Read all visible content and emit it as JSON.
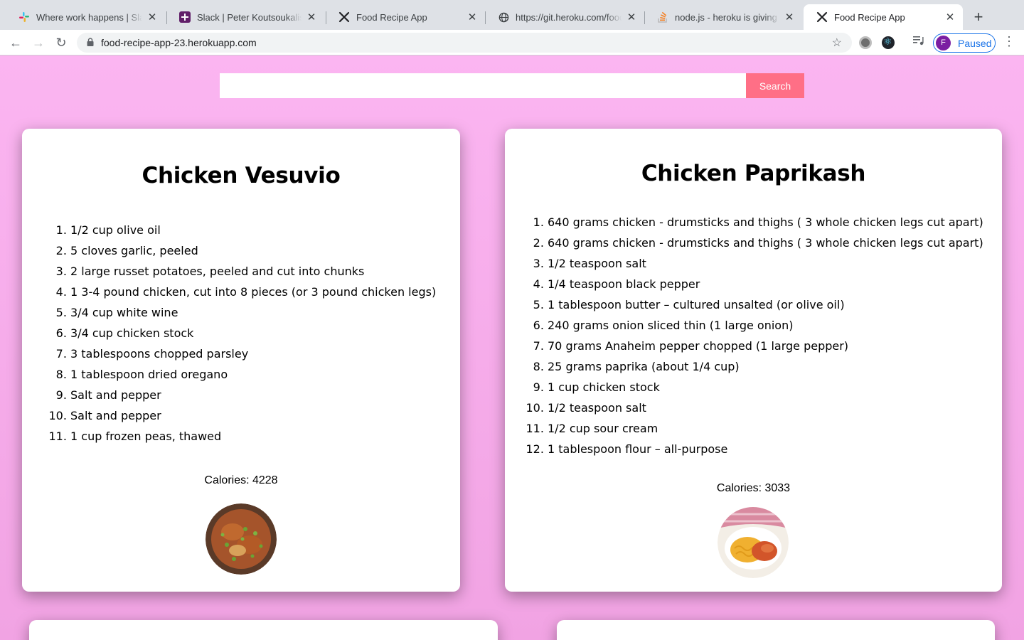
{
  "browser": {
    "tabs": [
      {
        "title": "Where work happens | Slack",
        "icon": "slack-icon"
      },
      {
        "title": "Slack | Peter Koutsoukalis | T",
        "icon": "slack-workspace-icon"
      },
      {
        "title": "Food Recipe App",
        "icon": "fork-knife-icon"
      },
      {
        "title": "https://git.heroku.com/food-",
        "icon": "globe-icon"
      },
      {
        "title": "node.js - heroku is giving me",
        "icon": "stackoverflow-icon"
      },
      {
        "title": "Food Recipe App",
        "icon": "fork-knife-icon",
        "active": true
      }
    ],
    "url": "food-recipe-app-23.herokuapp.com",
    "profile_initial": "F",
    "profile_status": "Paused"
  },
  "search": {
    "value": "",
    "button_label": "Search"
  },
  "recipes": [
    {
      "title": "Chicken Vesuvio",
      "ingredients": [
        "1/2 cup olive oil",
        "5 cloves garlic, peeled",
        "2 large russet potatoes, peeled and cut into chunks",
        "1 3-4 pound chicken, cut into 8 pieces (or 3 pound chicken legs)",
        "3/4 cup white wine",
        "3/4 cup chicken stock",
        "3 tablespoons chopped parsley",
        "1 tablespoon dried oregano",
        "Salt and pepper",
        "Salt and pepper",
        "1 cup frozen peas, thawed"
      ],
      "calories": "Calories: 4228"
    },
    {
      "title": "Chicken Paprikash",
      "ingredients": [
        "640 grams chicken - drumsticks and thighs ( 3 whole chicken legs cut apart)",
        "640 grams chicken - drumsticks and thighs ( 3 whole chicken legs cut apart)",
        "1/2 teaspoon salt",
        "1/4 teaspoon black pepper",
        "1 tablespoon butter – cultured unsalted (or olive oil)",
        "240 grams onion sliced thin (1 large onion)",
        "70 grams Anaheim pepper chopped (1 large pepper)",
        "25 grams paprika (about 1/4 cup)",
        "1 cup chicken stock",
        "1/2 teaspoon salt",
        "1/2 cup sour cream",
        "1 tablespoon flour – all-purpose"
      ],
      "calories": "Calories: 3033"
    }
  ],
  "colors": {
    "page_background": "#fbb5f1",
    "search_button": "#ff6f86",
    "profile_accent": "#1a73e8"
  }
}
